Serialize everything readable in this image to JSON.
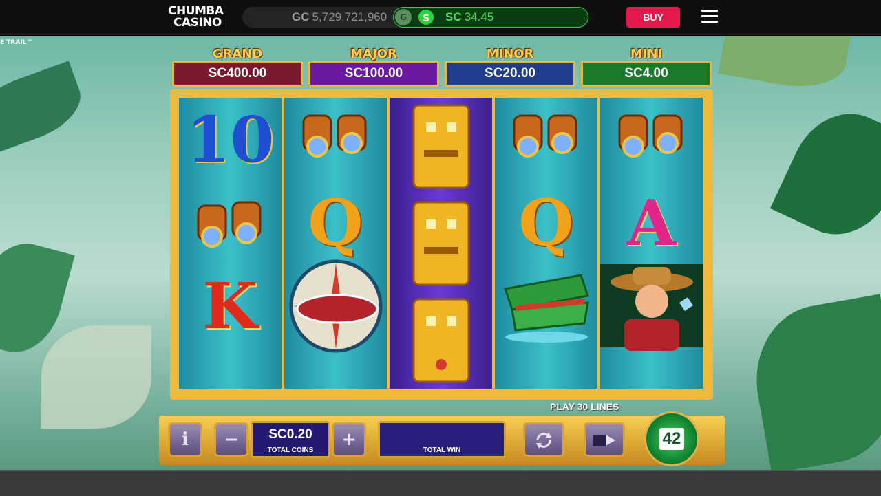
{
  "header": {
    "logo": {
      "line1": "CHUMBA",
      "line2": "CASINO"
    },
    "gc_label": "GC",
    "gc_value": "5,729,721,960",
    "toggle_g": "G",
    "toggle_s": "S",
    "sc_label": "SC",
    "sc_value": "34.45",
    "buy_label": "BUY"
  },
  "game_title_fragment": "E TRAIL™",
  "jackpots": [
    {
      "name": "GRAND",
      "value": "SC400.00",
      "color": "#7a1a2e"
    },
    {
      "name": "MAJOR",
      "value": "SC100.00",
      "color": "#6a1aa0"
    },
    {
      "name": "MINOR",
      "value": "SC20.00",
      "color": "#1f3f8c"
    },
    {
      "name": "MINI",
      "value": "SC4.00",
      "color": "#1a7a2a"
    }
  ],
  "reels": [
    [
      "10",
      "binoculars",
      "K"
    ],
    [
      "binoculars",
      "Q",
      "compass-boat"
    ],
    [
      "totem",
      "totem",
      "totem"
    ],
    [
      "binoculars",
      "Q",
      "crocodile"
    ],
    [
      "binoculars",
      "A",
      "explorer"
    ]
  ],
  "controls": {
    "info": "i",
    "minus": "−",
    "plus": "+",
    "total_coins_value": "SC0.20",
    "total_coins_label": "TOTAL COINS",
    "total_win_label": "TOTAL WIN",
    "play_lines": "PLAY 30 LINES",
    "spin_count": "42"
  },
  "colors": {
    "brand_red": "#e5194c",
    "sc_green": "#4de35c"
  }
}
